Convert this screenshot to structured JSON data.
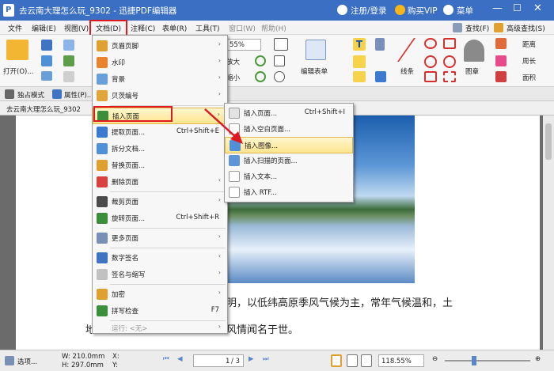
{
  "window": {
    "title": "去云南大理怎么玩_9302 - 迅捷PDF编辑器",
    "login": "注册/登录",
    "vip": "购买VIP",
    "menu": "菜单"
  },
  "menubar": [
    "文件",
    "编辑(E)",
    "视图(V)",
    "文档(D)",
    "注释(C)",
    "表单(R)",
    "工具(T)",
    "窗口(W)",
    "帮助(H)"
  ],
  "ribbon": {
    "open": "打开(O)...",
    "zoom": "55%",
    "zoom_in": "放大",
    "zoom_out": "缩小",
    "edit_form": "编辑表单",
    "line": "线条",
    "stamp": "图章",
    "distance": "距离",
    "perimeter": "周长",
    "area": "面积",
    "find": "查找(F)",
    "advanced_find": "高级查找(S)"
  },
  "toolbar": {
    "exclusive": "独占模式",
    "properties": "属性(P)..."
  },
  "doc_tab": "去云南大理怎么玩_9302",
  "doc_menu": {
    "items": [
      {
        "label": "页眉页脚",
        "shortcut": "",
        "arrow": "›"
      },
      {
        "label": "水印",
        "shortcut": "",
        "arrow": "›"
      },
      {
        "label": "背景",
        "shortcut": "",
        "arrow": "›"
      },
      {
        "label": "贝茨编号",
        "shortcut": "",
        "arrow": "›"
      },
      {
        "label": "插入页面",
        "shortcut": "",
        "arrow": "›"
      },
      {
        "label": "提取页面...",
        "shortcut": "Ctrl+Shift+E",
        "arrow": ""
      },
      {
        "label": "拆分文档...",
        "shortcut": "",
        "arrow": ""
      },
      {
        "label": "替换页面...",
        "shortcut": "",
        "arrow": ""
      },
      {
        "label": "删除页面",
        "shortcut": "",
        "arrow": "›"
      },
      {
        "label": "裁剪页面",
        "shortcut": "",
        "arrow": "›"
      },
      {
        "label": "旋转页面...",
        "shortcut": "Ctrl+Shift+R",
        "arrow": ""
      },
      {
        "label": "更多页面",
        "shortcut": "",
        "arrow": "›"
      },
      {
        "label": "数字签名",
        "shortcut": "",
        "arrow": "›"
      },
      {
        "label": "签名与缩写",
        "shortcut": "",
        "arrow": "›"
      },
      {
        "label": "加密",
        "shortcut": "",
        "arrow": "›"
      },
      {
        "label": "拼写检查",
        "shortcut": "F7",
        "arrow": ""
      },
      {
        "label": "运行: <无>",
        "shortcut": "",
        "arrow": "›"
      }
    ]
  },
  "submenu": {
    "items": [
      {
        "label": "插入页面...",
        "shortcut": "Ctrl+Shift+I"
      },
      {
        "label": "插入空白页面...",
        "shortcut": ""
      },
      {
        "label": "插入图像...",
        "shortcut": ""
      },
      {
        "label": "插入扫描的页面...",
        "shortcut": ""
      },
      {
        "label": "插入文本...",
        "shortcut": ""
      },
      {
        "label": "插入 RTF...",
        "shortcut": ""
      }
    ]
  },
  "page_text": {
    "line1": "明，以低纬高原季风气候为主，常年气候温和，土",
    "line2": "风情闻名于世。",
    "line2_prefix": "地"
  },
  "status": {
    "options": "选项...",
    "width": "W: 210.0mm",
    "height": "H: 297.0mm",
    "x": "X:",
    "y": "Y:",
    "page": "1",
    "pages": "/ 3",
    "zoom": "118.55%"
  },
  "colors": {
    "title_bar": "#3a6fc4",
    "highlight": "#fde58e",
    "red_box": "#e0181f"
  }
}
